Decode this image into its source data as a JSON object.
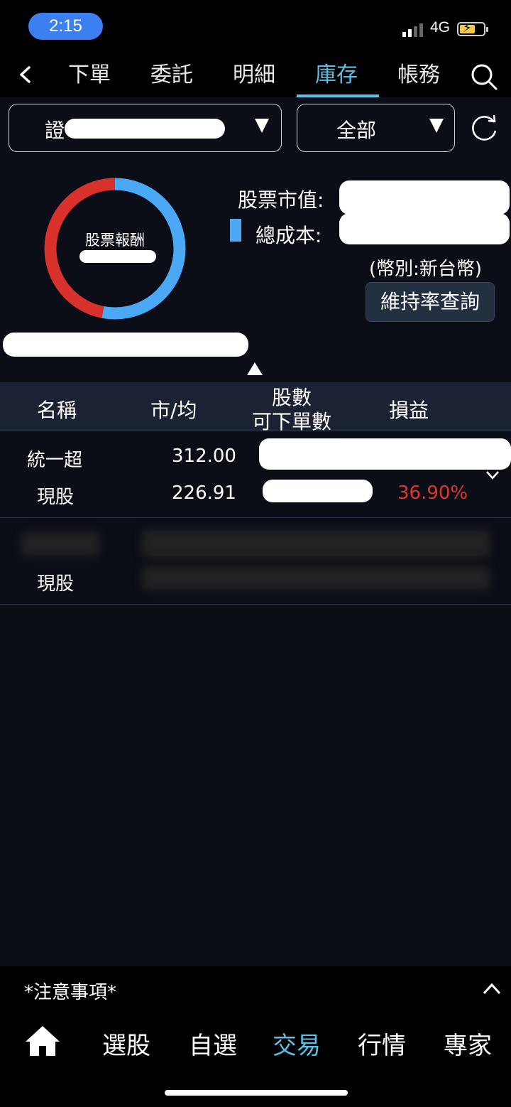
{
  "status": {
    "time": "2:15",
    "network": "4G"
  },
  "nav": {
    "tabs": [
      "下單",
      "委託",
      "明細",
      "庫存",
      "帳務"
    ],
    "active_tab": "庫存"
  },
  "filters": {
    "account_prefix": "證",
    "category": "全部"
  },
  "summary": {
    "donut_label": "股票報酬",
    "stock_value_label": "股票市值:",
    "total_cost_label": "總成本:",
    "currency_note": "(幣別:新台幣)",
    "margin_button": "維持率查詢",
    "colors": {
      "cost": "#4aa8f5",
      "gain": "#d9312b"
    },
    "donut_split": {
      "blue_fraction": 0.53,
      "red_fraction": 0.47
    }
  },
  "table": {
    "headers": {
      "name": "名稱",
      "price": "市/均",
      "shares_line1": "股數",
      "shares_line2": "可下單數",
      "pnl": "損益"
    },
    "rows": [
      {
        "name": "統一超",
        "type": "現股",
        "market_price": "312.00",
        "avg_price": "226.91",
        "pnl": "36.90%"
      },
      {
        "name": "",
        "type": "現股",
        "market_price": "",
        "avg_price": "",
        "pnl": ""
      }
    ]
  },
  "footer": {
    "notice": "*注意事項*",
    "bottom_nav": [
      "選股",
      "自選",
      "交易",
      "行情",
      "專家"
    ],
    "active": "交易"
  }
}
